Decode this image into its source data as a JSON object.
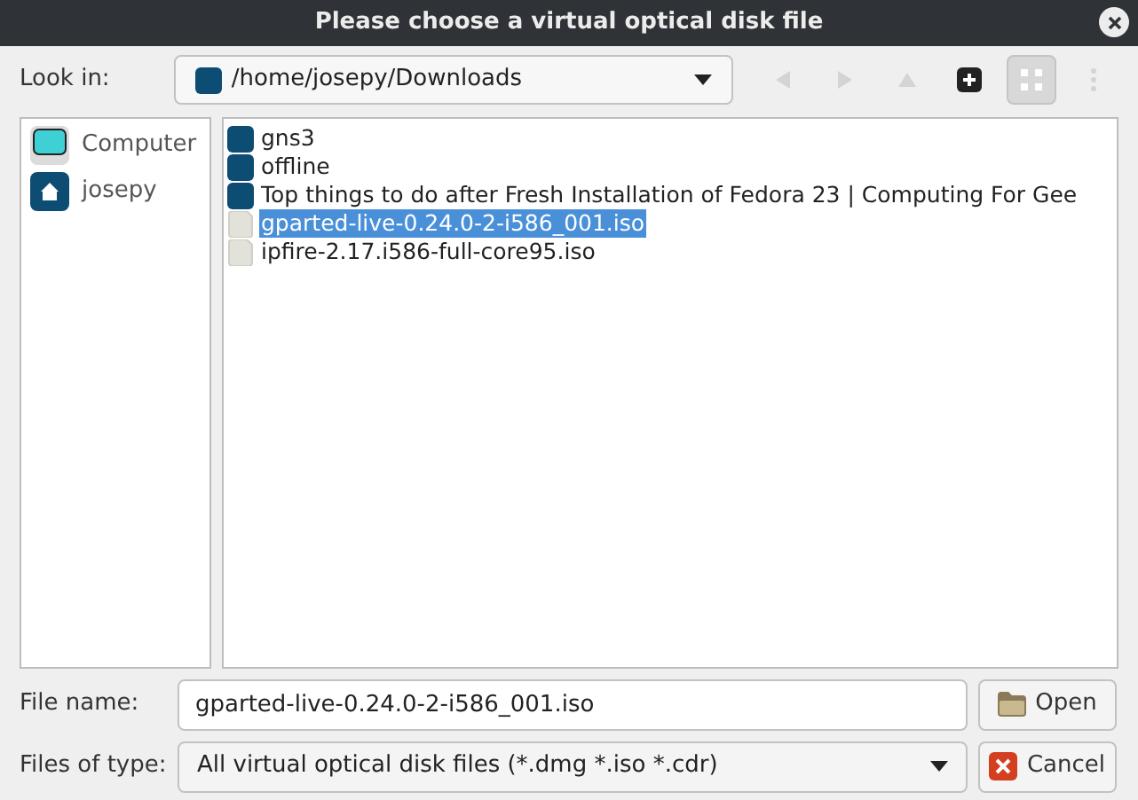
{
  "window": {
    "title": "Please choose a virtual optical disk file"
  },
  "look_in": {
    "label": "Look in:",
    "value": "/home/josepy/Downloads"
  },
  "toolbar": [
    {
      "kind": "back",
      "disabled": true
    },
    {
      "kind": "forward",
      "disabled": true
    },
    {
      "kind": "up",
      "disabled": true
    },
    {
      "kind": "new-folder",
      "disabled": false
    },
    {
      "kind": "view",
      "disabled": false,
      "selected": true
    },
    {
      "kind": "menu",
      "disabled": true
    }
  ],
  "sidebar": {
    "items": [
      {
        "kind": "computer",
        "label": "Computer"
      },
      {
        "kind": "home",
        "label": "josepy"
      }
    ]
  },
  "files": [
    {
      "kind": "folder",
      "name": "gns3",
      "selected": false
    },
    {
      "kind": "folder",
      "name": "offline",
      "selected": false
    },
    {
      "kind": "folder",
      "name": "Top things to do after Fresh Installation of Fedora 23 | Computing For Gee",
      "selected": false
    },
    {
      "kind": "file",
      "name": "gparted-live-0.24.0-2-i586_001.iso",
      "selected": true
    },
    {
      "kind": "file",
      "name": "ipfire-2.17.i586-full-core95.iso",
      "selected": false
    }
  ],
  "file_name": {
    "label": "File name:",
    "value": "gparted-live-0.24.0-2-i586_001.iso"
  },
  "file_type": {
    "label": "Files of type:",
    "value": "All virtual optical disk files (*.dmg *.iso *.cdr)"
  },
  "buttons": [
    {
      "kind": "open",
      "label": "Open"
    },
    {
      "kind": "cancel",
      "label": "Cancel"
    }
  ]
}
